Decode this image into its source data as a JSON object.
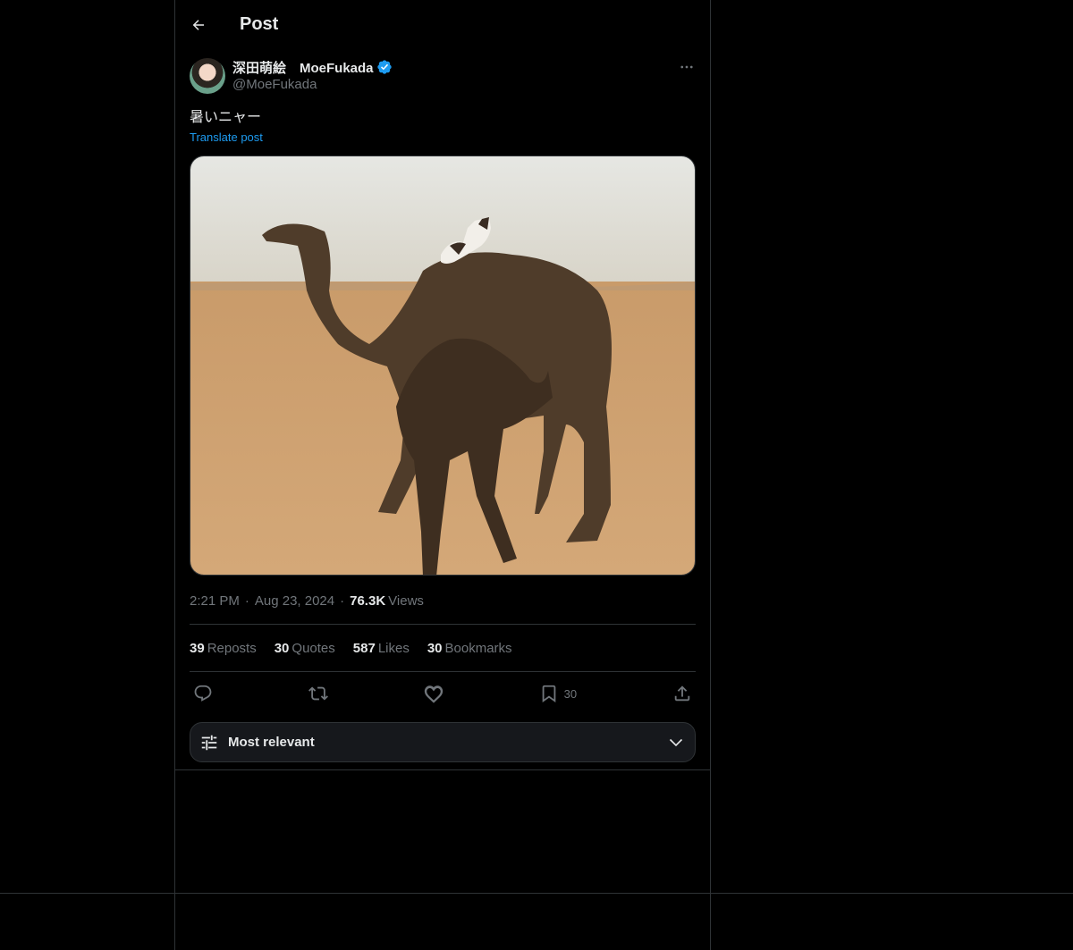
{
  "header": {
    "title": "Post",
    "back_icon": "arrow-left-icon"
  },
  "post": {
    "author": {
      "display_name": "深田萌絵　MoeFukada",
      "handle": "@MoeFukada",
      "verified": true,
      "verified_color": "#1d9bf0"
    },
    "text": "暑いニャー",
    "translate_label": "Translate post",
    "media_alt": "Camels in desert with cat on back",
    "meta": {
      "time": "2:21 PM",
      "separator": "·",
      "date": "Aug 23, 2024",
      "views_count": "76.3K",
      "views_label": "Views"
    },
    "stats": {
      "reposts_count": "39",
      "reposts_label": "Reposts",
      "quotes_count": "30",
      "quotes_label": "Quotes",
      "likes_count": "587",
      "likes_label": "Likes",
      "bookmarks_count": "30",
      "bookmarks_label": "Bookmarks"
    },
    "actions": {
      "reply_icon": "reply-icon",
      "repost_icon": "repost-icon",
      "like_icon": "heart-icon",
      "bookmark_icon": "bookmark-icon",
      "bookmark_count": "30",
      "share_icon": "share-icon"
    }
  },
  "replies": {
    "sort_label": "Most relevant",
    "sort_icon": "sliders-icon",
    "chevron_icon": "chevron-down-icon"
  },
  "colors": {
    "background": "#000000",
    "text_primary": "#e7e9ea",
    "text_secondary": "#71767b",
    "accent": "#1d9bf0",
    "border": "#2f3336"
  }
}
